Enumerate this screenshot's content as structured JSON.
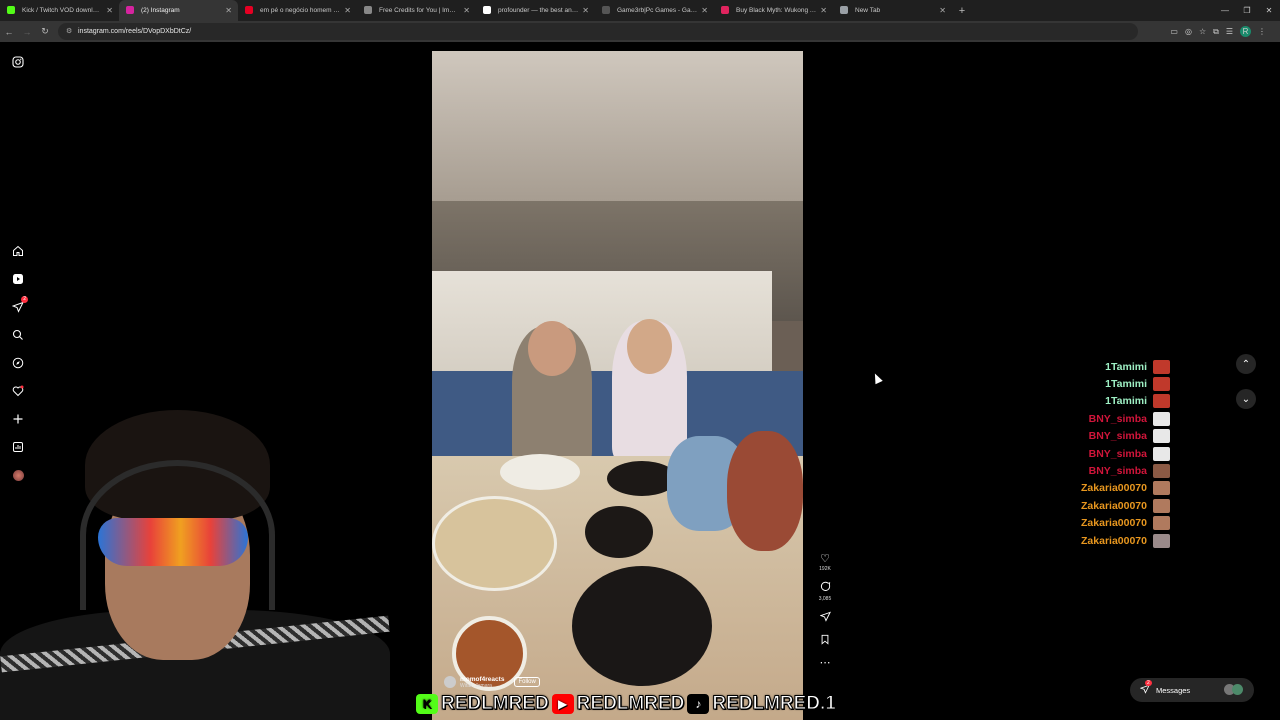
{
  "browser": {
    "tabs": [
      {
        "title": "Kick / Twitch VOD downloader",
        "fav_color": "#53fc18",
        "active": false
      },
      {
        "title": "(2) Instagram",
        "fav_color": "#d6249f",
        "active": true
      },
      {
        "title": "em pé o negócio homem apoi…",
        "fav_color": "#e60023",
        "active": false
      },
      {
        "title": "Free Credits for You | Image to…",
        "fav_color": "#888888",
        "active": false
      },
      {
        "title": "profounder — the best and free…",
        "fav_color": "#ffffff",
        "active": false
      },
      {
        "title": "Game3rb|Pc Games - Games Onl…",
        "fav_color": "#555555",
        "active": false
      },
      {
        "title": "Buy Black Myth: Wukong Accou…",
        "fav_color": "#e0245e",
        "active": false
      },
      {
        "title": "New Tab",
        "fav_color": "#9aa0a6",
        "active": false
      }
    ],
    "url": "instagram.com/reels/DVopDXbDtCz/",
    "profile_initial": "R"
  },
  "sidebar": {
    "notifications_badge": "2"
  },
  "reel": {
    "username": "momof4reacts",
    "subtitle": "Wifak, Jemara",
    "follow_label": "Follow",
    "likes": "192K",
    "comments": "3,085"
  },
  "chat": [
    {
      "user": "1Tamimi",
      "color": "#9ef0c4",
      "emote_color": "#c0392b"
    },
    {
      "user": "1Tamimi",
      "color": "#9ef0c4",
      "emote_color": "#c0392b"
    },
    {
      "user": "1Tamimi",
      "color": "#9ef0c4",
      "emote_color": "#c0392b"
    },
    {
      "user": "BNY_simba",
      "color": "#d0153a",
      "emote_color": "#e8e8e8"
    },
    {
      "user": "BNY_simba",
      "color": "#d0153a",
      "emote_color": "#e8e8e8"
    },
    {
      "user": "BNY_simba",
      "color": "#d0153a",
      "emote_color": "#e8e8e8"
    },
    {
      "user": "BNY_simba",
      "color": "#d0153a",
      "emote_color": "#8b5a45"
    },
    {
      "user": "Zakaria00070",
      "color": "#e8971f",
      "emote_color": "#b07a5e"
    },
    {
      "user": "Zakaria00070",
      "color": "#e8971f",
      "emote_color": "#b07a5e"
    },
    {
      "user": "Zakaria00070",
      "color": "#e8971f",
      "emote_color": "#b07a5e"
    },
    {
      "user": "Zakaria00070",
      "color": "#e8971f",
      "emote_color": "#9a8a8a"
    }
  ],
  "messages": {
    "label": "Messages",
    "badge": "2"
  },
  "social_banner": {
    "kick": "REDLMRED",
    "youtube": "REDLMRED",
    "tiktok": "REDLMRED.1"
  }
}
